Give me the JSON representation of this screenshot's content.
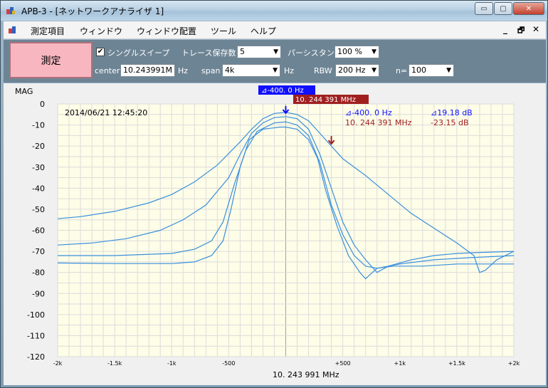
{
  "window": {
    "title": "APB-3 - [ネットワークアナライザ 1]",
    "buttons": {
      "minimize": "▭",
      "maximize": "▢",
      "close": "✕"
    }
  },
  "menu": {
    "items": [
      "測定項目",
      "ウィンドウ",
      "ウィンドウ配置",
      "ツール",
      "ヘルプ"
    ],
    "mdi": {
      "minimize": "_",
      "restore": "🗗",
      "close": "✕"
    }
  },
  "toolbar": {
    "measure_button": "測定",
    "single_sweep": {
      "label": "シングルスイープ",
      "checked": true
    },
    "trace_keep": {
      "label": "トレース保存数",
      "value": "5"
    },
    "persistence": {
      "label": "パーシスタンス",
      "value": "100 %"
    },
    "center": {
      "label": "center",
      "value": "10.243991M",
      "unit": "Hz"
    },
    "span": {
      "label": "span",
      "value": "4k",
      "unit": "Hz"
    },
    "rbw": {
      "label": "RBW",
      "value": "200 Hz"
    },
    "n": {
      "label": "n=",
      "value": "100"
    }
  },
  "chart": {
    "ylabel": "MAG",
    "timestamp": "2014/06/21 12:45:20",
    "marker_delta_tag": "⊿-400. 0 Hz",
    "marker_freq_tag": "10. 244 391 MHz",
    "readout": {
      "delta_freq": "⊿-400. 0 Hz",
      "delta_db": "⊿19.18 dB",
      "freq": "10. 244 391 MHz",
      "db": "-23.15 dB"
    },
    "xlabel": "10. 243 991 MHz",
    "colors": {
      "plot_bg": "#fdfde8",
      "grid": "#dcdcdc",
      "trace": "#3a8fdc",
      "marker_blue": "#1010ff",
      "marker_red": "#a02020"
    }
  },
  "chart_data": {
    "type": "line",
    "ylim": [
      -120,
      0
    ],
    "xlim": [
      -2000,
      2000
    ],
    "y_ticks": [
      "0",
      "-10",
      "-20",
      "-30",
      "-40",
      "-50",
      "-60",
      "-70",
      "-80",
      "-90",
      "-100",
      "-110",
      "-120"
    ],
    "x_ticks": [
      "-2k",
      "-1.5k",
      "-1k",
      "-500",
      "0",
      "+500",
      "+1k",
      "+1.5k",
      "+2k"
    ],
    "series": [
      {
        "values": [
          [
            -2000,
            -54.5
          ],
          [
            -1800,
            -53.5
          ],
          [
            -1500,
            -51
          ],
          [
            -1200,
            -47
          ],
          [
            -1000,
            -43
          ],
          [
            -800,
            -37
          ],
          [
            -600,
            -29
          ],
          [
            -400,
            -18
          ],
          [
            -300,
            -12
          ],
          [
            -200,
            -7
          ],
          [
            -100,
            -4.5
          ],
          [
            0,
            -4
          ],
          [
            100,
            -5
          ],
          [
            200,
            -8
          ],
          [
            300,
            -14
          ],
          [
            400,
            -20
          ],
          [
            500,
            -26
          ],
          [
            700,
            -34
          ],
          [
            900,
            -43
          ],
          [
            1100,
            -52
          ],
          [
            1300,
            -59
          ],
          [
            1500,
            -66
          ],
          [
            1650,
            -72
          ],
          [
            1700,
            -80
          ],
          [
            1750,
            -79
          ],
          [
            1850,
            -74
          ],
          [
            2000,
            -70
          ]
        ]
      },
      {
        "values": [
          [
            -2000,
            -67
          ],
          [
            -1700,
            -66
          ],
          [
            -1400,
            -64
          ],
          [
            -1100,
            -60
          ],
          [
            -900,
            -55
          ],
          [
            -700,
            -48
          ],
          [
            -500,
            -35
          ],
          [
            -400,
            -24
          ],
          [
            -300,
            -14
          ],
          [
            -200,
            -9
          ],
          [
            -100,
            -6.5
          ],
          [
            0,
            -6
          ],
          [
            100,
            -7
          ],
          [
            200,
            -12
          ],
          [
            300,
            -24
          ],
          [
            400,
            -40
          ],
          [
            500,
            -56
          ],
          [
            600,
            -67
          ],
          [
            700,
            -74
          ],
          [
            800,
            -80
          ],
          [
            900,
            -77
          ],
          [
            1100,
            -74
          ],
          [
            1300,
            -72
          ],
          [
            1500,
            -71
          ],
          [
            1700,
            -70.5
          ],
          [
            2000,
            -70
          ]
        ]
      },
      {
        "values": [
          [
            -2000,
            -72
          ],
          [
            -1500,
            -72
          ],
          [
            -1000,
            -71
          ],
          [
            -800,
            -69
          ],
          [
            -650,
            -65
          ],
          [
            -550,
            -56
          ],
          [
            -450,
            -38
          ],
          [
            -350,
            -22
          ],
          [
            -250,
            -13
          ],
          [
            -100,
            -9
          ],
          [
            0,
            -8.5
          ],
          [
            100,
            -10
          ],
          [
            200,
            -15
          ],
          [
            300,
            -28
          ],
          [
            400,
            -48
          ],
          [
            500,
            -62
          ],
          [
            600,
            -72
          ],
          [
            700,
            -77
          ],
          [
            800,
            -78
          ],
          [
            1000,
            -76
          ],
          [
            1300,
            -74
          ],
          [
            1600,
            -73
          ],
          [
            2000,
            -72
          ]
        ]
      },
      {
        "values": [
          [
            -2000,
            -75.5
          ],
          [
            -1500,
            -75.8
          ],
          [
            -1000,
            -75.8
          ],
          [
            -800,
            -75
          ],
          [
            -650,
            -72
          ],
          [
            -550,
            -65
          ],
          [
            -480,
            -50
          ],
          [
            -400,
            -30
          ],
          [
            -320,
            -17
          ],
          [
            -200,
            -12
          ],
          [
            -50,
            -11
          ],
          [
            0,
            -11
          ],
          [
            100,
            -12
          ],
          [
            200,
            -17
          ],
          [
            280,
            -26
          ],
          [
            350,
            -41
          ],
          [
            450,
            -58
          ],
          [
            550,
            -72
          ],
          [
            650,
            -80
          ],
          [
            700,
            -83
          ],
          [
            800,
            -78
          ],
          [
            950,
            -77
          ],
          [
            1200,
            -77
          ],
          [
            1500,
            -76
          ],
          [
            2000,
            -76
          ]
        ]
      }
    ]
  }
}
